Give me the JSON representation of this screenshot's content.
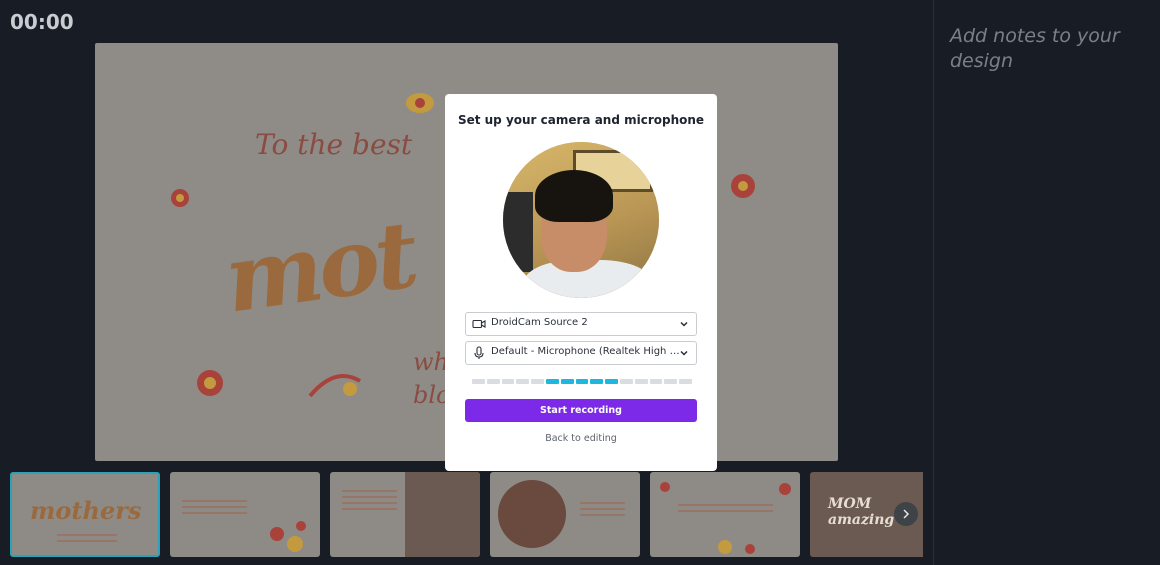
{
  "timer": "00:00",
  "notes": {
    "placeholder": "Add notes to your design"
  },
  "slide": {
    "line1": "To the best",
    "big": "mot",
    "fragment1": "wh",
    "fragment2": "blo"
  },
  "thumbnails": [
    {
      "title": "mothers",
      "active": true
    },
    {
      "title": "",
      "active": false
    },
    {
      "title": "",
      "active": false
    },
    {
      "title": "",
      "active": false
    },
    {
      "title": "",
      "active": false
    },
    {
      "title": "MOM amazing",
      "active": false
    }
  ],
  "modal": {
    "title": "Set up your camera and microphone",
    "camera_select": "DroidCam Source 2",
    "mic_select": "Default - Microphone (Realtek High Definition Audio)",
    "mic_level": {
      "segments": 15,
      "active_from": 5,
      "active_to": 9
    },
    "record_button": "Start recording",
    "back_link": "Back to editing"
  },
  "colors": {
    "accent": "#7d2ae8",
    "meter_active": "#1fb6e0",
    "thumb_active_border": "#2aa3b8"
  },
  "icons": {
    "camera": "video-camera-icon",
    "mic": "microphone-icon",
    "chevron": "chevron-down-icon",
    "next": "chevron-right-icon"
  }
}
